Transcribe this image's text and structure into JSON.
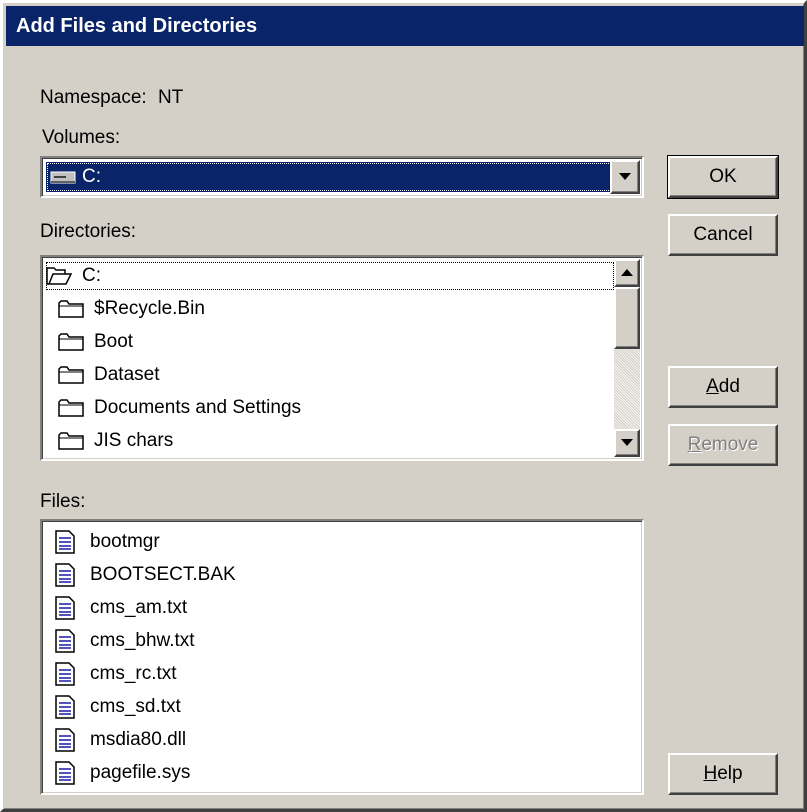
{
  "window": {
    "title": "Add Files and Directories"
  },
  "namespace": {
    "label": "Namespace:",
    "value": "NT"
  },
  "volumes": {
    "label": "Volumes:",
    "selected": "C:"
  },
  "directories": {
    "label": "Directories:",
    "items": [
      {
        "name": "C:",
        "icon": "open-folder-icon"
      },
      {
        "name": "$Recycle.Bin",
        "icon": "folder-icon"
      },
      {
        "name": "Boot",
        "icon": "folder-icon"
      },
      {
        "name": "Dataset",
        "icon": "folder-icon"
      },
      {
        "name": "Documents and Settings",
        "icon": "folder-icon"
      },
      {
        "name": "JIS chars",
        "icon": "folder-icon"
      }
    ]
  },
  "files": {
    "label": "Files:",
    "items": [
      "bootmgr",
      "BOOTSECT.BAK",
      "cms_am.txt",
      "cms_bhw.txt",
      "cms_rc.txt",
      "cms_sd.txt",
      "msdia80.dll",
      "pagefile.sys"
    ]
  },
  "buttons": {
    "ok": "OK",
    "cancel": "Cancel",
    "add": {
      "accel": "A",
      "rest": "dd"
    },
    "remove": {
      "accel": "R",
      "rest": "emove"
    },
    "help": {
      "accel": "H",
      "rest": "elp"
    }
  },
  "colors": {
    "titlebar": "#0a246a",
    "face": "#d4d0c8",
    "highlight": "#0a246a",
    "file_icon_lines": "#1a1aa6"
  }
}
